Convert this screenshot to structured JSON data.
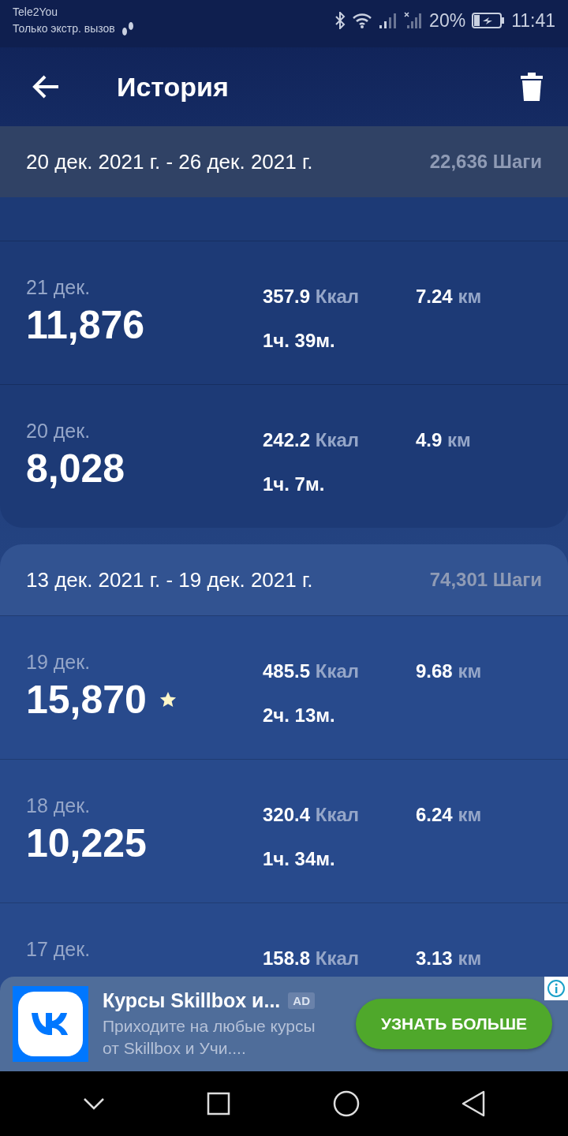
{
  "status_bar": {
    "carrier": "Tele2You",
    "carrier_note": "Только экстр. вызов",
    "battery": "20%",
    "time": "11:41"
  },
  "app_bar": {
    "title": "История"
  },
  "weeks": [
    {
      "range": "20 дек. 2021 г. - 26 дек. 2021 г.",
      "total": "22,636 Шаги",
      "cut_top": true,
      "days": [
        {
          "date": "21 дек.",
          "steps": "11,876",
          "starred": false,
          "kcal": "357.9",
          "kcal_unit": "Ккал",
          "duration": "1ч. 39м.",
          "km": "7.24",
          "km_unit": "км"
        },
        {
          "date": "20 дек.",
          "steps": "8,028",
          "starred": false,
          "kcal": "242.2",
          "kcal_unit": "Ккал",
          "duration": "1ч. 7м.",
          "km": "4.9",
          "km_unit": "км"
        }
      ]
    },
    {
      "range": "13 дек. 2021 г. - 19 дек. 2021 г.",
      "total": "74,301 Шаги",
      "cut_top": false,
      "days": [
        {
          "date": "19 дек.",
          "steps": "15,870",
          "starred": true,
          "kcal": "485.5",
          "kcal_unit": "Ккал",
          "duration": "2ч. 13м.",
          "km": "9.68",
          "km_unit": "км"
        },
        {
          "date": "18 дек.",
          "steps": "10,225",
          "starred": false,
          "kcal": "320.4",
          "kcal_unit": "Ккал",
          "duration": "1ч. 34м.",
          "km": "6.24",
          "km_unit": "км"
        },
        {
          "date": "17 дек.",
          "starred": false,
          "kcal": "158.8",
          "kcal_unit": "Ккал",
          "km": "3.13",
          "km_unit": "км"
        }
      ]
    }
  ],
  "ad": {
    "title": "Курсы Skillbox и...",
    "badge": "AD",
    "text": "Приходите на любые курсы от Skillbox и Учи....",
    "button": "УЗНАТЬ БОЛЬШЕ"
  }
}
